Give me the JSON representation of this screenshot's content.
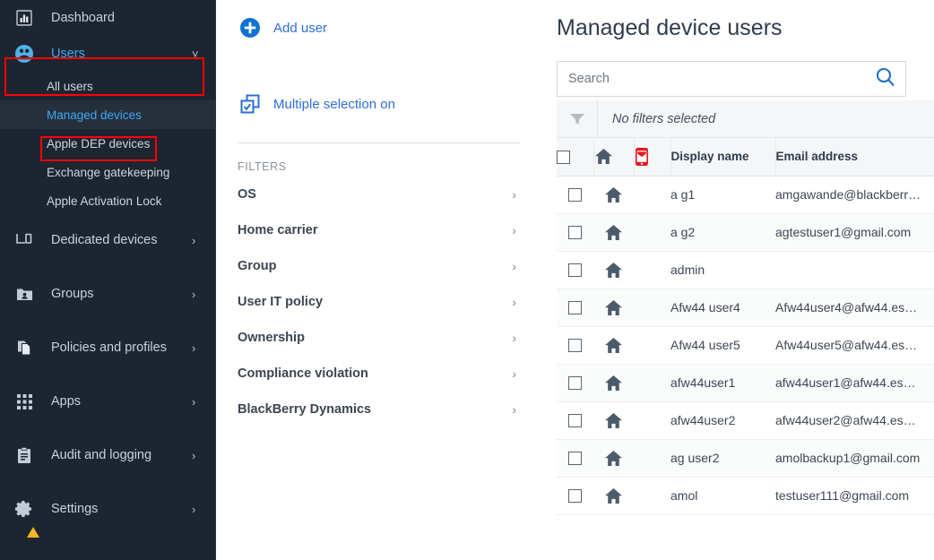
{
  "sidebar": {
    "items": [
      {
        "label": "Dashboard",
        "icon": "chart-bar-icon",
        "chevron": "",
        "active": false
      },
      {
        "label": "Users",
        "icon": "users-icon",
        "chevron": "˅",
        "active": true
      },
      {
        "label": "Dedicated devices",
        "icon": "dedicated-devices-icon",
        "chevron": "›",
        "active": false
      },
      {
        "label": "Groups",
        "icon": "groups-folder-icon",
        "chevron": "›",
        "active": false
      },
      {
        "label": "Policies and profiles",
        "icon": "documents-icon",
        "chevron": "›",
        "active": false
      },
      {
        "label": "Apps",
        "icon": "apps-grid-icon",
        "chevron": "›",
        "active": false
      },
      {
        "label": "Audit and logging",
        "icon": "clipboard-icon",
        "chevron": "›",
        "active": false
      },
      {
        "label": "Settings",
        "icon": "gear-icon",
        "chevron": "›",
        "active": false
      }
    ],
    "users_subitems": [
      {
        "label": "All users",
        "selected": false
      },
      {
        "label": "Managed devices",
        "selected": true
      },
      {
        "label": "Apple DEP devices",
        "selected": false
      },
      {
        "label": "Exchange gatekeeping",
        "selected": false
      },
      {
        "label": "Apple Activation Lock",
        "selected": false
      }
    ],
    "highlight_color": "#ff0000",
    "accent_color": "#3ea9f5",
    "background_color": "#1d2531"
  },
  "filter_panel": {
    "add_user_label": "Add user",
    "multiple_selection_label": "Multiple selection on",
    "filters_heading": "FILTERS",
    "filters": [
      {
        "label": "OS",
        "chevron": "›"
      },
      {
        "label": "Home carrier",
        "chevron": "›"
      },
      {
        "label": "Group",
        "chevron": "›"
      },
      {
        "label": "User IT policy",
        "chevron": "›"
      },
      {
        "label": "Ownership",
        "chevron": "›"
      },
      {
        "label": "Compliance violation",
        "chevron": "›"
      },
      {
        "label": "BlackBerry Dynamics",
        "chevron": "›"
      }
    ],
    "link_color": "#2d6fd4"
  },
  "main": {
    "title": "Managed device users",
    "search": {
      "value": "",
      "placeholder": "Search"
    },
    "filter_bar_text": "No filters selected",
    "columns": [
      {
        "key": "checkbox",
        "label": "",
        "icon": "checkbox-icon"
      },
      {
        "key": "home",
        "label": "",
        "icon": "home-icon"
      },
      {
        "key": "device",
        "label": "",
        "icon": "device-compliance-icon"
      },
      {
        "key": "display_name",
        "label": "Display name",
        "icon": ""
      },
      {
        "key": "email",
        "label": "Email address",
        "icon": ""
      }
    ],
    "rows": [
      {
        "display_name": "a g1",
        "email": "amgawande@blackberr…"
      },
      {
        "display_name": "a g2",
        "email": "agtestuser1@gmail.com"
      },
      {
        "display_name": "admin",
        "email": ""
      },
      {
        "display_name": "Afw44 user4",
        "email": "Afw44user4@afw44.es…"
      },
      {
        "display_name": "Afw44 user5",
        "email": "Afw44user5@afw44.es…"
      },
      {
        "display_name": "afw44user1",
        "email": "afw44user1@afw44.es…"
      },
      {
        "display_name": "afw44user2",
        "email": "afw44user2@afw44.es…"
      },
      {
        "display_name": "ag user2",
        "email": "amolbackup1@gmail.com"
      },
      {
        "display_name": "amol",
        "email": "testuser111@gmail.com"
      }
    ],
    "search_icon_color": "#1f6fc4",
    "device_icon_color": "#e8171f"
  }
}
